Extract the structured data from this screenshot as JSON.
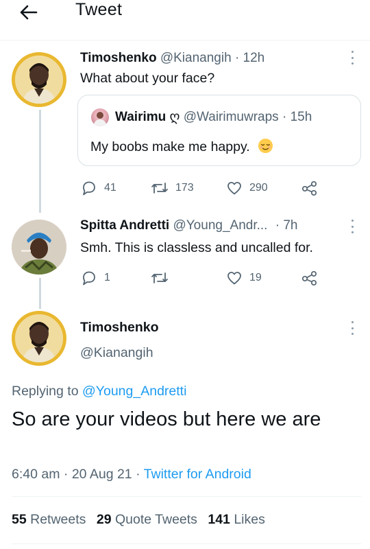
{
  "header": {
    "title": "Tweet",
    "back_icon": "arrow-left-icon"
  },
  "colors": {
    "link": "#1d9bf0",
    "muted": "#536471",
    "text": "#0f1419",
    "avatar_ring": "#e9b830"
  },
  "tweets": [
    {
      "name": "Timoshenko",
      "handle": "@Kianangih",
      "time": "12h",
      "text": "What about your face?",
      "quote": {
        "name": "Wairimu",
        "badge": "ღ",
        "handle": "@Wairimuwraps",
        "time": "15h",
        "text": "My boobs make me happy."
      },
      "replies": "41",
      "retweets": "173",
      "likes": "290"
    },
    {
      "name": "Spitta Andretti",
      "handle": "@Young_Andr...",
      "time": "7h",
      "text": "Smh. This is classless and uncalled for.",
      "replies": "1",
      "retweets": "",
      "likes": "19"
    }
  ],
  "main": {
    "name": "Timoshenko",
    "handle": "@Kianangih",
    "replying_prefix": "Replying to",
    "replying_handle": "@Young_Andretti",
    "text": "So are your videos but here we are",
    "time": "6:40 am",
    "date": "20 Aug 21",
    "source": "Twitter for Android",
    "retweets_count": "55",
    "retweets_label": "Retweets",
    "quotes_count": "29",
    "quotes_label": "Quote Tweets",
    "likes_count": "141",
    "likes_label": "Likes"
  }
}
